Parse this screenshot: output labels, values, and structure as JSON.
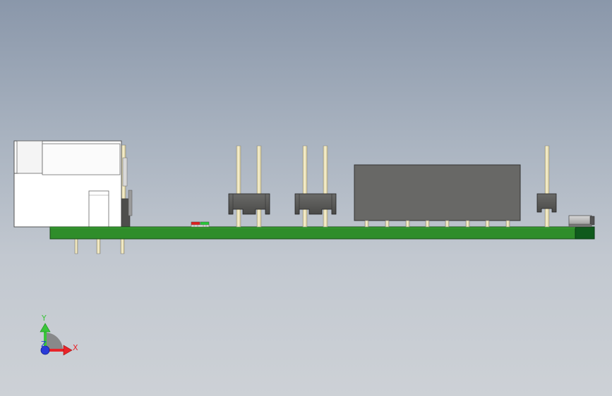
{
  "triad": {
    "x_label": "X",
    "y_label": "Y",
    "z_label": "Z",
    "x_color": "#e8242a",
    "y_color": "#3ac43a",
    "z_color": "#2a3ad8"
  },
  "colors": {
    "pcb": "#2a8a2a",
    "pcb_dark": "#0f5a1c",
    "pin": "#efe6b8",
    "header_body": "#5a5a58",
    "module_body": "#686866",
    "connector_body": "#ffffff"
  },
  "components": [
    {
      "name": "rj45-connector"
    },
    {
      "name": "smd-leds"
    },
    {
      "name": "pin-header-2x"
    },
    {
      "name": "pin-header-2x"
    },
    {
      "name": "dip-module"
    },
    {
      "name": "pin-header-1x"
    },
    {
      "name": "smd-switch"
    }
  ]
}
